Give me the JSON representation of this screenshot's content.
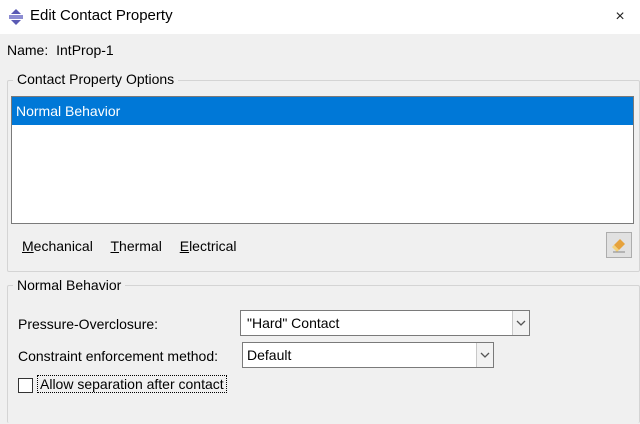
{
  "window": {
    "title": "Edit Contact Property",
    "icon": "abaqus-interaction-icon",
    "close_label": "×"
  },
  "name_field": {
    "label": "Name:",
    "value": "IntProp-1"
  },
  "options_group": {
    "legend": "Contact Property Options",
    "items": [
      {
        "label": "Normal Behavior",
        "selected": true
      }
    ]
  },
  "menu": {
    "mechanical": {
      "underline": "M",
      "rest": "echanical"
    },
    "thermal": {
      "underline": "T",
      "rest": "hermal"
    },
    "electrical": {
      "underline": "E",
      "rest": "lectrical"
    }
  },
  "behavior_group": {
    "legend": "Normal Behavior",
    "pressure_label": "Pressure-Overclosure:",
    "pressure_value": "\"Hard\" Contact",
    "constraint_label": "Constraint enforcement method:",
    "constraint_value": "Default",
    "allow_separation_label": "Allow separation after contact",
    "allow_separation_checked": false
  },
  "colors": {
    "selection": "#0078d7",
    "background": "#f0f0f0"
  }
}
